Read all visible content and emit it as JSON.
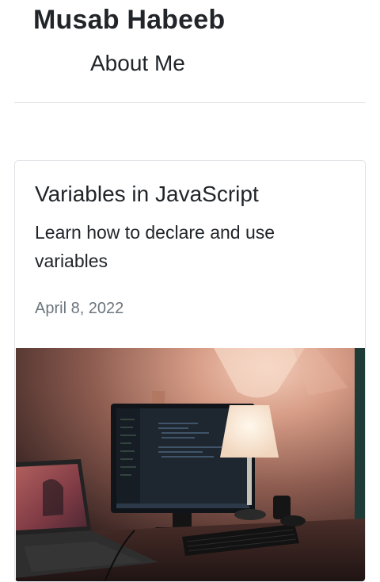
{
  "header": {
    "site_title": "Musab Habeeb",
    "nav_about": "About Me"
  },
  "post": {
    "title": "Variables in JavaScript",
    "description": "Learn how to declare and use variables",
    "date": "April 8, 2022",
    "image_alt": "Desk with computer monitor showing code, laptop, keyboard and lamp"
  },
  "colors": {
    "text": "#212529",
    "muted": "#6c757d",
    "border": "#dee2e6"
  }
}
